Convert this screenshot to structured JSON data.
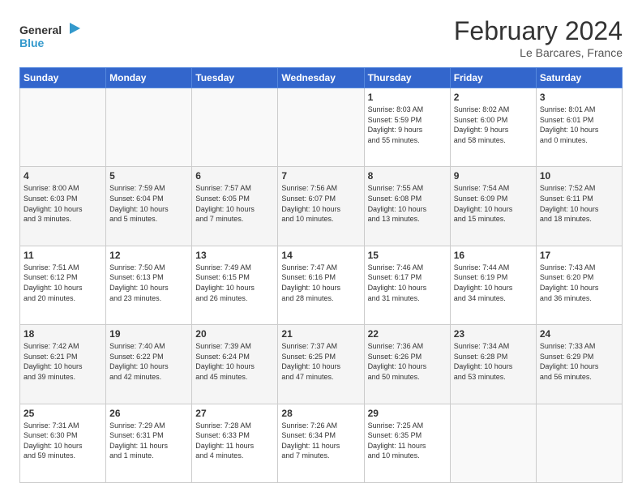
{
  "header": {
    "logo_line1": "General",
    "logo_line2": "Blue",
    "title": "February 2024",
    "subtitle": "Le Barcares, France"
  },
  "weekdays": [
    "Sunday",
    "Monday",
    "Tuesday",
    "Wednesday",
    "Thursday",
    "Friday",
    "Saturday"
  ],
  "weeks": [
    [
      {
        "day": "",
        "info": ""
      },
      {
        "day": "",
        "info": ""
      },
      {
        "day": "",
        "info": ""
      },
      {
        "day": "",
        "info": ""
      },
      {
        "day": "1",
        "info": "Sunrise: 8:03 AM\nSunset: 5:59 PM\nDaylight: 9 hours\nand 55 minutes."
      },
      {
        "day": "2",
        "info": "Sunrise: 8:02 AM\nSunset: 6:00 PM\nDaylight: 9 hours\nand 58 minutes."
      },
      {
        "day": "3",
        "info": "Sunrise: 8:01 AM\nSunset: 6:01 PM\nDaylight: 10 hours\nand 0 minutes."
      }
    ],
    [
      {
        "day": "4",
        "info": "Sunrise: 8:00 AM\nSunset: 6:03 PM\nDaylight: 10 hours\nand 3 minutes."
      },
      {
        "day": "5",
        "info": "Sunrise: 7:59 AM\nSunset: 6:04 PM\nDaylight: 10 hours\nand 5 minutes."
      },
      {
        "day": "6",
        "info": "Sunrise: 7:57 AM\nSunset: 6:05 PM\nDaylight: 10 hours\nand 7 minutes."
      },
      {
        "day": "7",
        "info": "Sunrise: 7:56 AM\nSunset: 6:07 PM\nDaylight: 10 hours\nand 10 minutes."
      },
      {
        "day": "8",
        "info": "Sunrise: 7:55 AM\nSunset: 6:08 PM\nDaylight: 10 hours\nand 13 minutes."
      },
      {
        "day": "9",
        "info": "Sunrise: 7:54 AM\nSunset: 6:09 PM\nDaylight: 10 hours\nand 15 minutes."
      },
      {
        "day": "10",
        "info": "Sunrise: 7:52 AM\nSunset: 6:11 PM\nDaylight: 10 hours\nand 18 minutes."
      }
    ],
    [
      {
        "day": "11",
        "info": "Sunrise: 7:51 AM\nSunset: 6:12 PM\nDaylight: 10 hours\nand 20 minutes."
      },
      {
        "day": "12",
        "info": "Sunrise: 7:50 AM\nSunset: 6:13 PM\nDaylight: 10 hours\nand 23 minutes."
      },
      {
        "day": "13",
        "info": "Sunrise: 7:49 AM\nSunset: 6:15 PM\nDaylight: 10 hours\nand 26 minutes."
      },
      {
        "day": "14",
        "info": "Sunrise: 7:47 AM\nSunset: 6:16 PM\nDaylight: 10 hours\nand 28 minutes."
      },
      {
        "day": "15",
        "info": "Sunrise: 7:46 AM\nSunset: 6:17 PM\nDaylight: 10 hours\nand 31 minutes."
      },
      {
        "day": "16",
        "info": "Sunrise: 7:44 AM\nSunset: 6:19 PM\nDaylight: 10 hours\nand 34 minutes."
      },
      {
        "day": "17",
        "info": "Sunrise: 7:43 AM\nSunset: 6:20 PM\nDaylight: 10 hours\nand 36 minutes."
      }
    ],
    [
      {
        "day": "18",
        "info": "Sunrise: 7:42 AM\nSunset: 6:21 PM\nDaylight: 10 hours\nand 39 minutes."
      },
      {
        "day": "19",
        "info": "Sunrise: 7:40 AM\nSunset: 6:22 PM\nDaylight: 10 hours\nand 42 minutes."
      },
      {
        "day": "20",
        "info": "Sunrise: 7:39 AM\nSunset: 6:24 PM\nDaylight: 10 hours\nand 45 minutes."
      },
      {
        "day": "21",
        "info": "Sunrise: 7:37 AM\nSunset: 6:25 PM\nDaylight: 10 hours\nand 47 minutes."
      },
      {
        "day": "22",
        "info": "Sunrise: 7:36 AM\nSunset: 6:26 PM\nDaylight: 10 hours\nand 50 minutes."
      },
      {
        "day": "23",
        "info": "Sunrise: 7:34 AM\nSunset: 6:28 PM\nDaylight: 10 hours\nand 53 minutes."
      },
      {
        "day": "24",
        "info": "Sunrise: 7:33 AM\nSunset: 6:29 PM\nDaylight: 10 hours\nand 56 minutes."
      }
    ],
    [
      {
        "day": "25",
        "info": "Sunrise: 7:31 AM\nSunset: 6:30 PM\nDaylight: 10 hours\nand 59 minutes."
      },
      {
        "day": "26",
        "info": "Sunrise: 7:29 AM\nSunset: 6:31 PM\nDaylight: 11 hours\nand 1 minute."
      },
      {
        "day": "27",
        "info": "Sunrise: 7:28 AM\nSunset: 6:33 PM\nDaylight: 11 hours\nand 4 minutes."
      },
      {
        "day": "28",
        "info": "Sunrise: 7:26 AM\nSunset: 6:34 PM\nDaylight: 11 hours\nand 7 minutes."
      },
      {
        "day": "29",
        "info": "Sunrise: 7:25 AM\nSunset: 6:35 PM\nDaylight: 11 hours\nand 10 minutes."
      },
      {
        "day": "",
        "info": ""
      },
      {
        "day": "",
        "info": ""
      }
    ]
  ]
}
